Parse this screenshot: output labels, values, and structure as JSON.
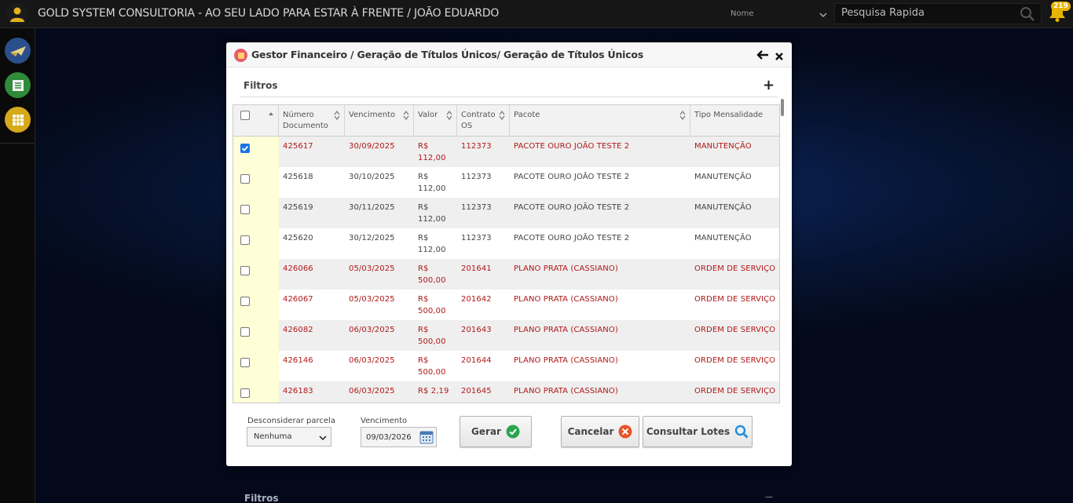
{
  "topbar": {
    "title": "GOLD SYSTEM CONSULTORIA - AO SEU LADO PARA ESTAR À FRENTE / JOÃO EDUARDO",
    "search_type": "Nome",
    "search_placeholder": "Pesquisa Rapida",
    "notification_count": "219"
  },
  "background": {
    "filtros_label": "Filtros"
  },
  "modal": {
    "title": "Gestor Financeiro / Geração de Títulos Únicos/ Geração de Títulos Únicos",
    "filtros_label": "Filtros",
    "filtros_add": "+",
    "columns": [
      {
        "label": "",
        "sort": true
      },
      {
        "label": "Número Documento",
        "sort": true
      },
      {
        "label": "Vencimento",
        "sort": true
      },
      {
        "label": "Valor",
        "sort": true
      },
      {
        "label": "Contrato OS",
        "sort": true
      },
      {
        "label": "Pacote",
        "sort": true
      },
      {
        "label": "Tipo Mensalidade",
        "sort": false
      }
    ],
    "rows": [
      {
        "checked": true,
        "red": true,
        "num": "425617",
        "venc": "30/09/2025",
        "valor": "R$ 112,00",
        "contrato": "112373",
        "pacote": "PACOTE OURO JOÃO TESTE 2",
        "tipo": "MANUTENÇÃO"
      },
      {
        "checked": false,
        "red": false,
        "num": "425618",
        "venc": "30/10/2025",
        "valor": "R$ 112,00",
        "contrato": "112373",
        "pacote": "PACOTE OURO JOÃO TESTE 2",
        "tipo": "MANUTENÇÃO"
      },
      {
        "checked": false,
        "red": false,
        "num": "425619",
        "venc": "30/11/2025",
        "valor": "R$ 112,00",
        "contrato": "112373",
        "pacote": "PACOTE OURO JOÃO TESTE 2",
        "tipo": "MANUTENÇÃO"
      },
      {
        "checked": false,
        "red": false,
        "num": "425620",
        "venc": "30/12/2025",
        "valor": "R$ 112,00",
        "contrato": "112373",
        "pacote": "PACOTE OURO JOÃO TESTE 2",
        "tipo": "MANUTENÇÃO"
      },
      {
        "checked": false,
        "red": true,
        "num": "426066",
        "venc": "05/03/2025",
        "valor": "R$ 500,00",
        "contrato": "201641",
        "pacote": "PLANO PRATA (CASSIANO)",
        "tipo": "ORDEM DE SERVIÇO"
      },
      {
        "checked": false,
        "red": true,
        "num": "426067",
        "venc": "05/03/2025",
        "valor": "R$ 500,00",
        "contrato": "201642",
        "pacote": "PLANO PRATA (CASSIANO)",
        "tipo": "ORDEM DE SERVIÇO"
      },
      {
        "checked": false,
        "red": true,
        "num": "426082",
        "venc": "06/03/2025",
        "valor": "R$ 500,00",
        "contrato": "201643",
        "pacote": "PLANO PRATA (CASSIANO)",
        "tipo": "ORDEM DE SERVIÇO"
      },
      {
        "checked": false,
        "red": true,
        "num": "426146",
        "venc": "06/03/2025",
        "valor": "R$ 500,00",
        "contrato": "201644",
        "pacote": "PLANO PRATA (CASSIANO)",
        "tipo": "ORDEM DE SERVIÇO"
      },
      {
        "checked": false,
        "red": true,
        "num": "426183",
        "venc": "06/03/2025",
        "valor": "R$ 2,19",
        "contrato": "201645",
        "pacote": "PLANO PRATA (CASSIANO)",
        "tipo": "ORDEM DE SERVIÇO"
      }
    ],
    "footer": {
      "desconsiderar_label": "Desconsiderar parcela",
      "desconsiderar_value": "Nenhuma",
      "vencimento_label": "Vencimento",
      "vencimento_value": "09/03/2026",
      "gerar_label": "Gerar",
      "cancelar_label": "Cancelar",
      "consultar_label": "Consultar Lotes"
    }
  },
  "colors": {
    "red_text": "#b01818",
    "checkbox_column": "#fefed7",
    "gerar_icon": "#2ea44f",
    "cancelar_icon": "#e8542a",
    "consultar_icon": "#2b8fd6"
  }
}
